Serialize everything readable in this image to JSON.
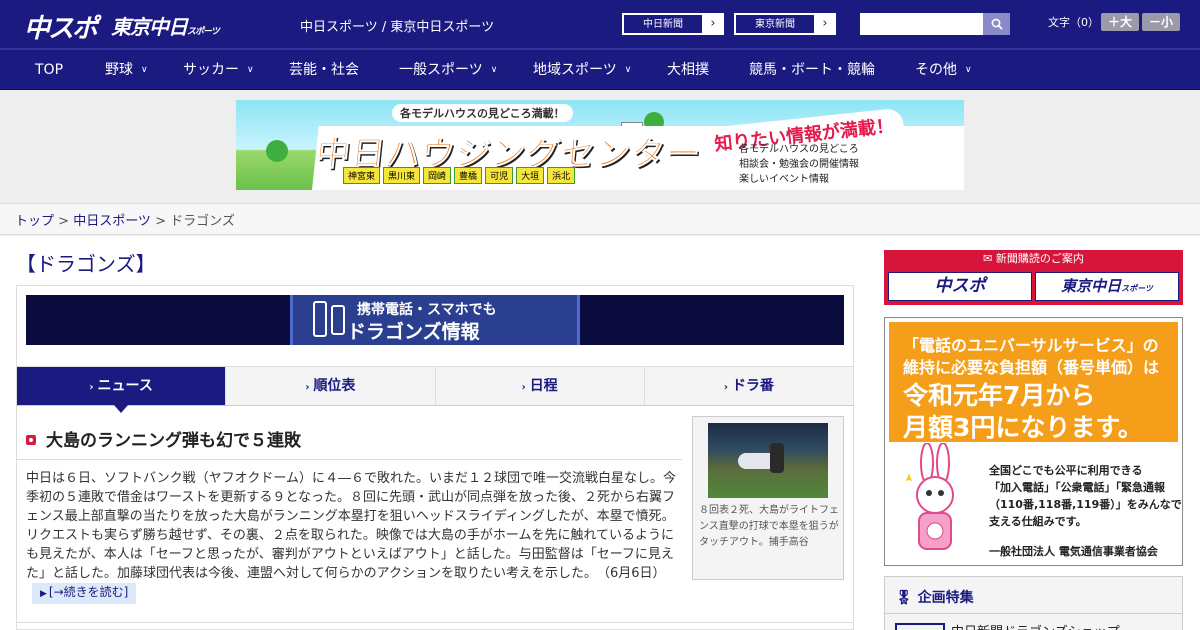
{
  "header": {
    "logo_chuspo": "中スポ",
    "logo_tokyo": "東京中日",
    "logo_tokyo_small": "スポーツ",
    "site_title": "中日スポーツ / 東京中日スポーツ",
    "paper_links": [
      {
        "label": "中日新聞",
        "arrow": "›"
      },
      {
        "label": "東京新聞",
        "arrow": "›"
      }
    ],
    "search_placeholder": "",
    "font_label": "文字（0）",
    "font_larger": "＋大",
    "font_smaller": "－小"
  },
  "nav": {
    "items": [
      {
        "label": "TOP",
        "has_menu": false
      },
      {
        "label": "野球",
        "has_menu": true
      },
      {
        "label": "サッカー",
        "has_menu": true
      },
      {
        "label": "芸能・社会",
        "has_menu": false
      },
      {
        "label": "一般スポーツ",
        "has_menu": true
      },
      {
        "label": "地域スポーツ",
        "has_menu": true
      },
      {
        "label": "大相撲",
        "has_menu": false
      },
      {
        "label": "競馬・ボート・競輪",
        "has_menu": false
      },
      {
        "label": "その他",
        "has_menu": true
      }
    ]
  },
  "banner": {
    "top_text": "各モデルハウスの見どころ満載！",
    "main_text": "中日ハウジングセンター",
    "sub_text": "知りたい情報が満載！",
    "info_lines": [
      "各モデルハウスの見どころ",
      "相談会・勉強会の開催情報",
      "楽しいイベント情報"
    ],
    "cities": [
      "神宮東",
      "黒川東",
      "岡崎",
      "豊橋",
      "可児",
      "大垣",
      "浜北"
    ]
  },
  "breadcrumb": {
    "home": "トップ",
    "sep": " > ",
    "section": "中日スポーツ",
    "current": "ドラゴンズ"
  },
  "page": {
    "title": "【ドラゴンズ】"
  },
  "mobile_banner": {
    "line1": "携帯電話・スマホでも",
    "line2": "ドラゴンズ情報"
  },
  "tabs": [
    {
      "label": "ニュース",
      "active": true
    },
    {
      "label": "順位表",
      "active": false
    },
    {
      "label": "日程",
      "active": false
    },
    {
      "label": "ドラ番",
      "active": false
    }
  ],
  "article": {
    "title": "大島のランニング弾も幻で５連敗",
    "body": "中日は６日、ソフトバンク戦（ヤフオクドーム）に４―６で敗れた。いまだ１２球団で唯一交流戦白星なし。今季初の５連敗で借金はワーストを更新する９となった。８回に先頭・武山が同点弾を放った後、２死から右翼フェンス最上部直撃の当たりを放った大島がランニング本塁打を狙いヘッドスライディングしたが、本塁で憤死。リクエストも実らず勝ち越せず、その裏、２点を取られた。映像では大島の手がホームを先に触れているようにも見えたが、本人は「セーフと思ったが、審判がアウトといえばアウト」と話した。与田監督は「セーフに見えた」と話した。加藤球団代表は今後、連盟へ対して何らかのアクションを取りたい考えを示した。",
    "date": "（6月6日）",
    "more_label": "[→続きを読む]",
    "photo_caption": "８回表２死、大島がライトフェンス直撃の打球で本塁を狙うがタッチアウト。捕手高谷"
  },
  "sidebar": {
    "subscribe_header": "新聞購読のご案内",
    "subscribe_chuspo": "中スポ",
    "subscribe_tokyo": "東京中日",
    "subscribe_tokyo_small": "スポーツ",
    "ad_line1": "「電話のユニバーサルサービス」の",
    "ad_line2": "維持に必要な負担額（番号単価）は",
    "ad_line3": "令和元年7月から",
    "ad_line4": "月額3円になります。",
    "ad_small": [
      "全国どこでも公平に利用できる",
      "「加入電話」「公衆電話」「緊急通報",
      "（110番,118番,119番）」をみんなで",
      "支える仕組みです。"
    ],
    "ad_org": "一般社団法人 電気通信事業者協会",
    "feature_header": "企画特集",
    "feature_item": "中日新聞ドラゴンズショップ"
  },
  "colors": {
    "brand_navy": "#1b1a80",
    "accent_red": "#d7153a",
    "ad_orange": "#f59e1a"
  }
}
